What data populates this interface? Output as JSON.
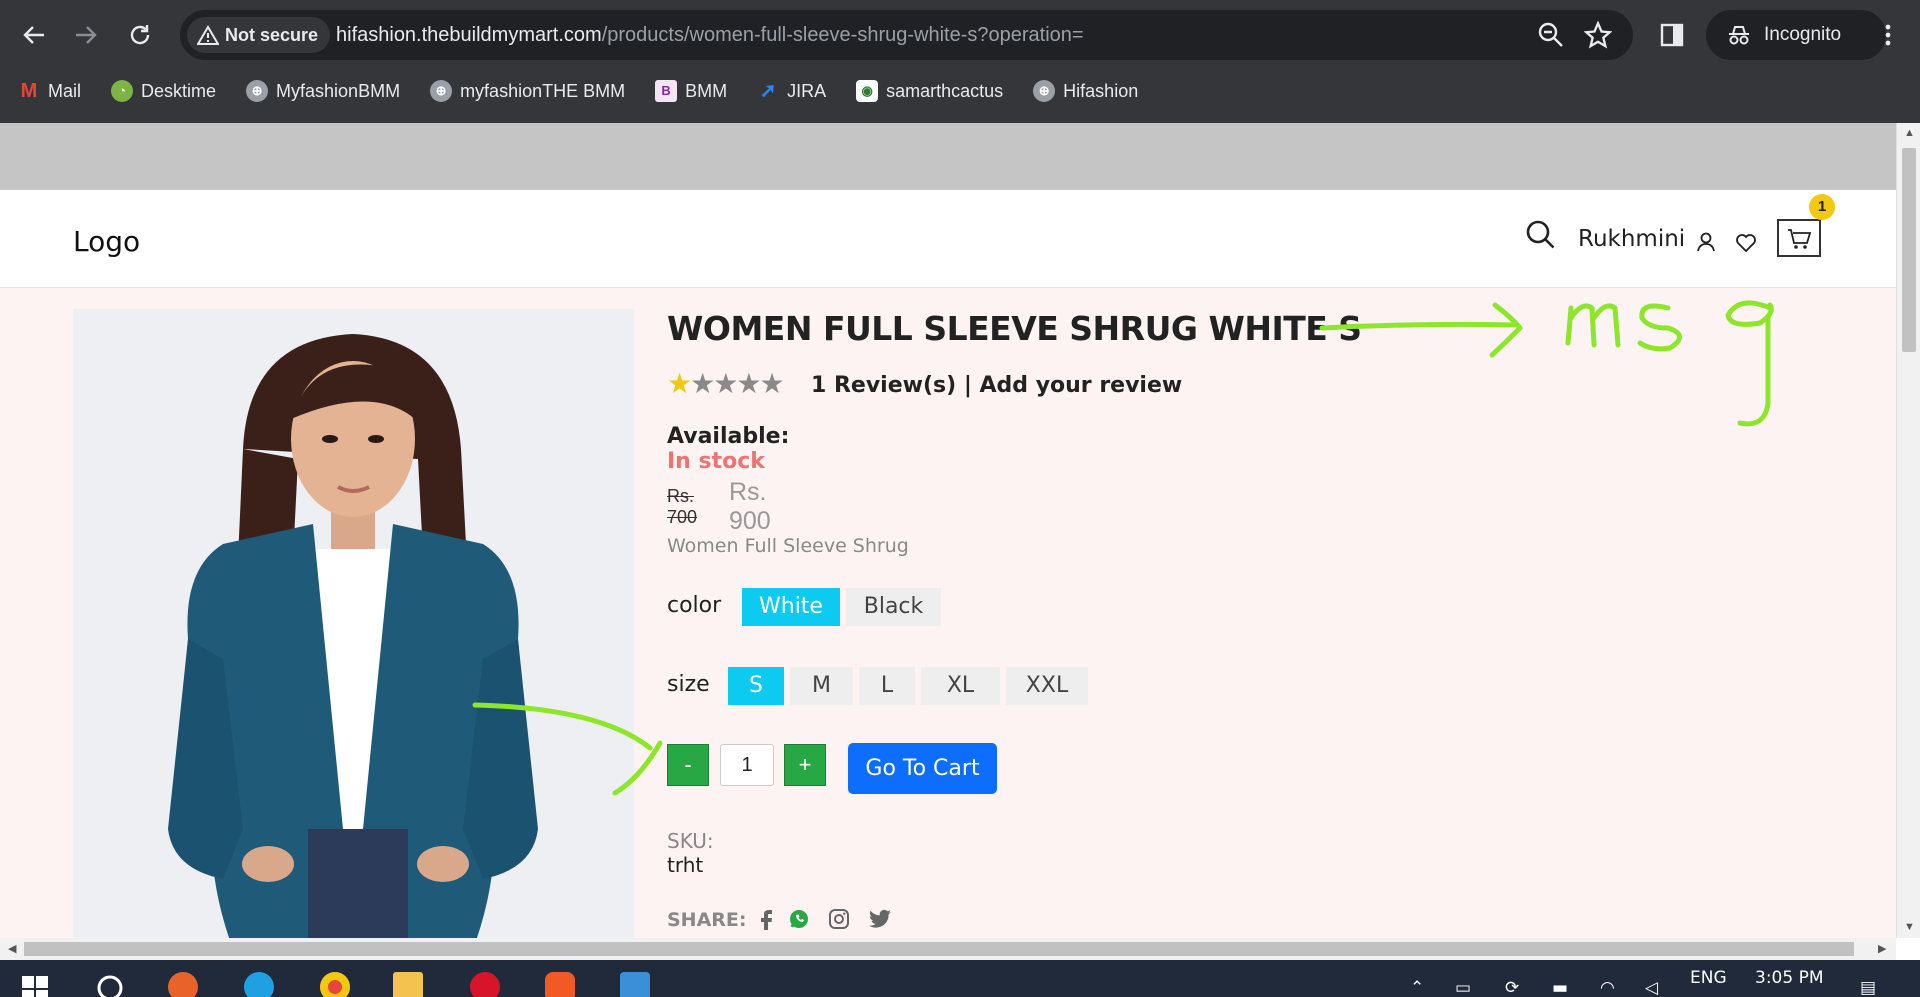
{
  "browser": {
    "security_label": "Not secure",
    "url_host": "hifashion.thebuildmymart.com",
    "url_path": "/products/women-full-sleeve-shrug-white-s?operation=",
    "incognito_label": "Incognito",
    "bookmarks": [
      {
        "label": "Mail",
        "icon": "gmail-icon"
      },
      {
        "label": "Desktime",
        "icon": "desktime-icon"
      },
      {
        "label": "MyfashionBMM",
        "icon": "globe-icon"
      },
      {
        "label": "myfashionTHE BMM",
        "icon": "globe-icon"
      },
      {
        "label": "BMM",
        "icon": "bmm-icon"
      },
      {
        "label": "JIRA",
        "icon": "jira-icon"
      },
      {
        "label": "samarthcactus",
        "icon": "cactus-icon"
      },
      {
        "label": "Hifashion",
        "icon": "globe-icon"
      }
    ]
  },
  "header": {
    "logo": "Logo",
    "username": "Rukhmini",
    "cart_count": "1"
  },
  "product": {
    "title": "WOMEN FULL SLEEVE SHRUG WHITE S",
    "rating": 1,
    "rating_max": 5,
    "reviews_text": "1 Review(s) | Add your review",
    "availability_label": "Available:",
    "availability_value": "In stock",
    "price_old": "Rs. 700",
    "price_new": "Rs. 900",
    "description": "Women Full Sleeve Shrug",
    "color_label": "color",
    "colors": [
      "White",
      "Black"
    ],
    "selected_color": "White",
    "size_label": "size",
    "sizes": [
      "S",
      "M",
      "L",
      "XL",
      "XXL"
    ],
    "selected_size": "S",
    "qty_minus": "-",
    "qty_value": "1",
    "qty_plus": "+",
    "cart_button": "Go To Cart",
    "sku_label": "SKU:",
    "sku_value": "trht",
    "share_label": "SHARE:"
  },
  "annotation": {
    "text": "msg",
    "color": "#8ee62a"
  },
  "taskbar": {
    "language": "ENG",
    "time": "3:05 PM"
  },
  "colors": {
    "accent_cyan": "#0dcaf0",
    "go_cart_blue": "#0d6efd",
    "qty_green": "#28a745",
    "in_stock": "#f07373",
    "star_yellow": "#f2c811",
    "page_bg": "#fdf3f3"
  }
}
